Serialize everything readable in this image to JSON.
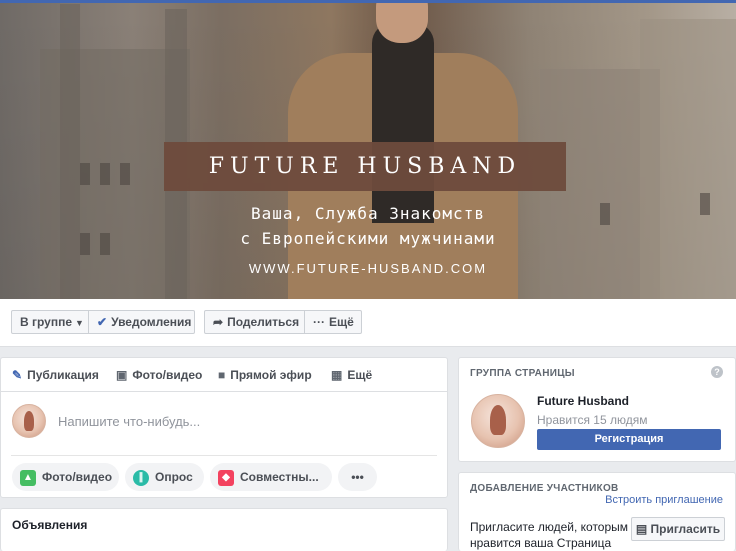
{
  "cover": {
    "title": "FUTURE HUSBAND",
    "subtitle_line1": "Ваша, Служба Знакомств",
    "subtitle_line2": "с Европейскими мужчинами",
    "url": "WWW.FUTURE-HUSBAND.COM"
  },
  "actions": {
    "in_group": "В группе",
    "notifications": "Уведомления",
    "share": "Поделиться",
    "more": "Ещё"
  },
  "composer": {
    "tabs": [
      "Публикация",
      "Фото/видео",
      "Прямой эфир",
      "Ещё"
    ],
    "placeholder": "Напишите что-нибудь...",
    "options": [
      "Фото/видео",
      "Опрос",
      "Совместны...",
      "•••"
    ]
  },
  "ads": {
    "title": "Объявления"
  },
  "group": {
    "header": "ГРУППА СТРАНИЦЫ",
    "help": "?",
    "name": "Future Husband",
    "likes": "Нравится 15 людям",
    "button": "Регистрация"
  },
  "members": {
    "header": "ДОБАВЛЕНИЕ УЧАСТНИКОВ",
    "invite_link": "Встроить приглашение",
    "text": "Пригласите людей, которым нравится ваша Страница",
    "button": "Пригласить"
  },
  "colors": {
    "brand": "#4267b2",
    "cover_banner": "#6e4b3c"
  }
}
